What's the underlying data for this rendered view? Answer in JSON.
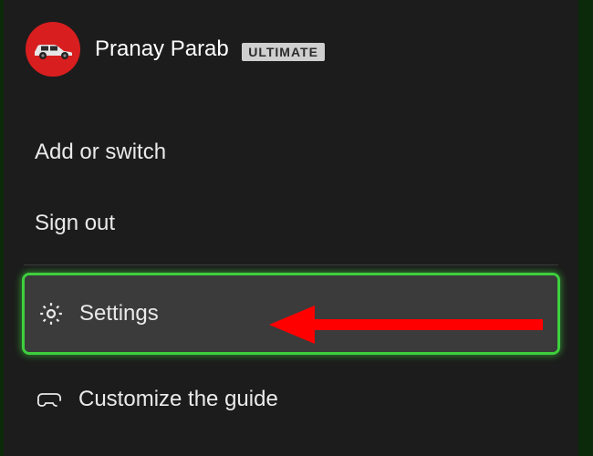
{
  "profile": {
    "username": "Pranay Parab",
    "badge": "ULTIMATE",
    "avatar_icon": "car-icon",
    "avatar_bg": "#d81e1e"
  },
  "menu": {
    "add_or_switch": "Add or switch",
    "sign_out": "Sign out",
    "settings": "Settings",
    "customize": "Customize the guide"
  },
  "annotation": {
    "arrow_color": "#ff0000"
  }
}
